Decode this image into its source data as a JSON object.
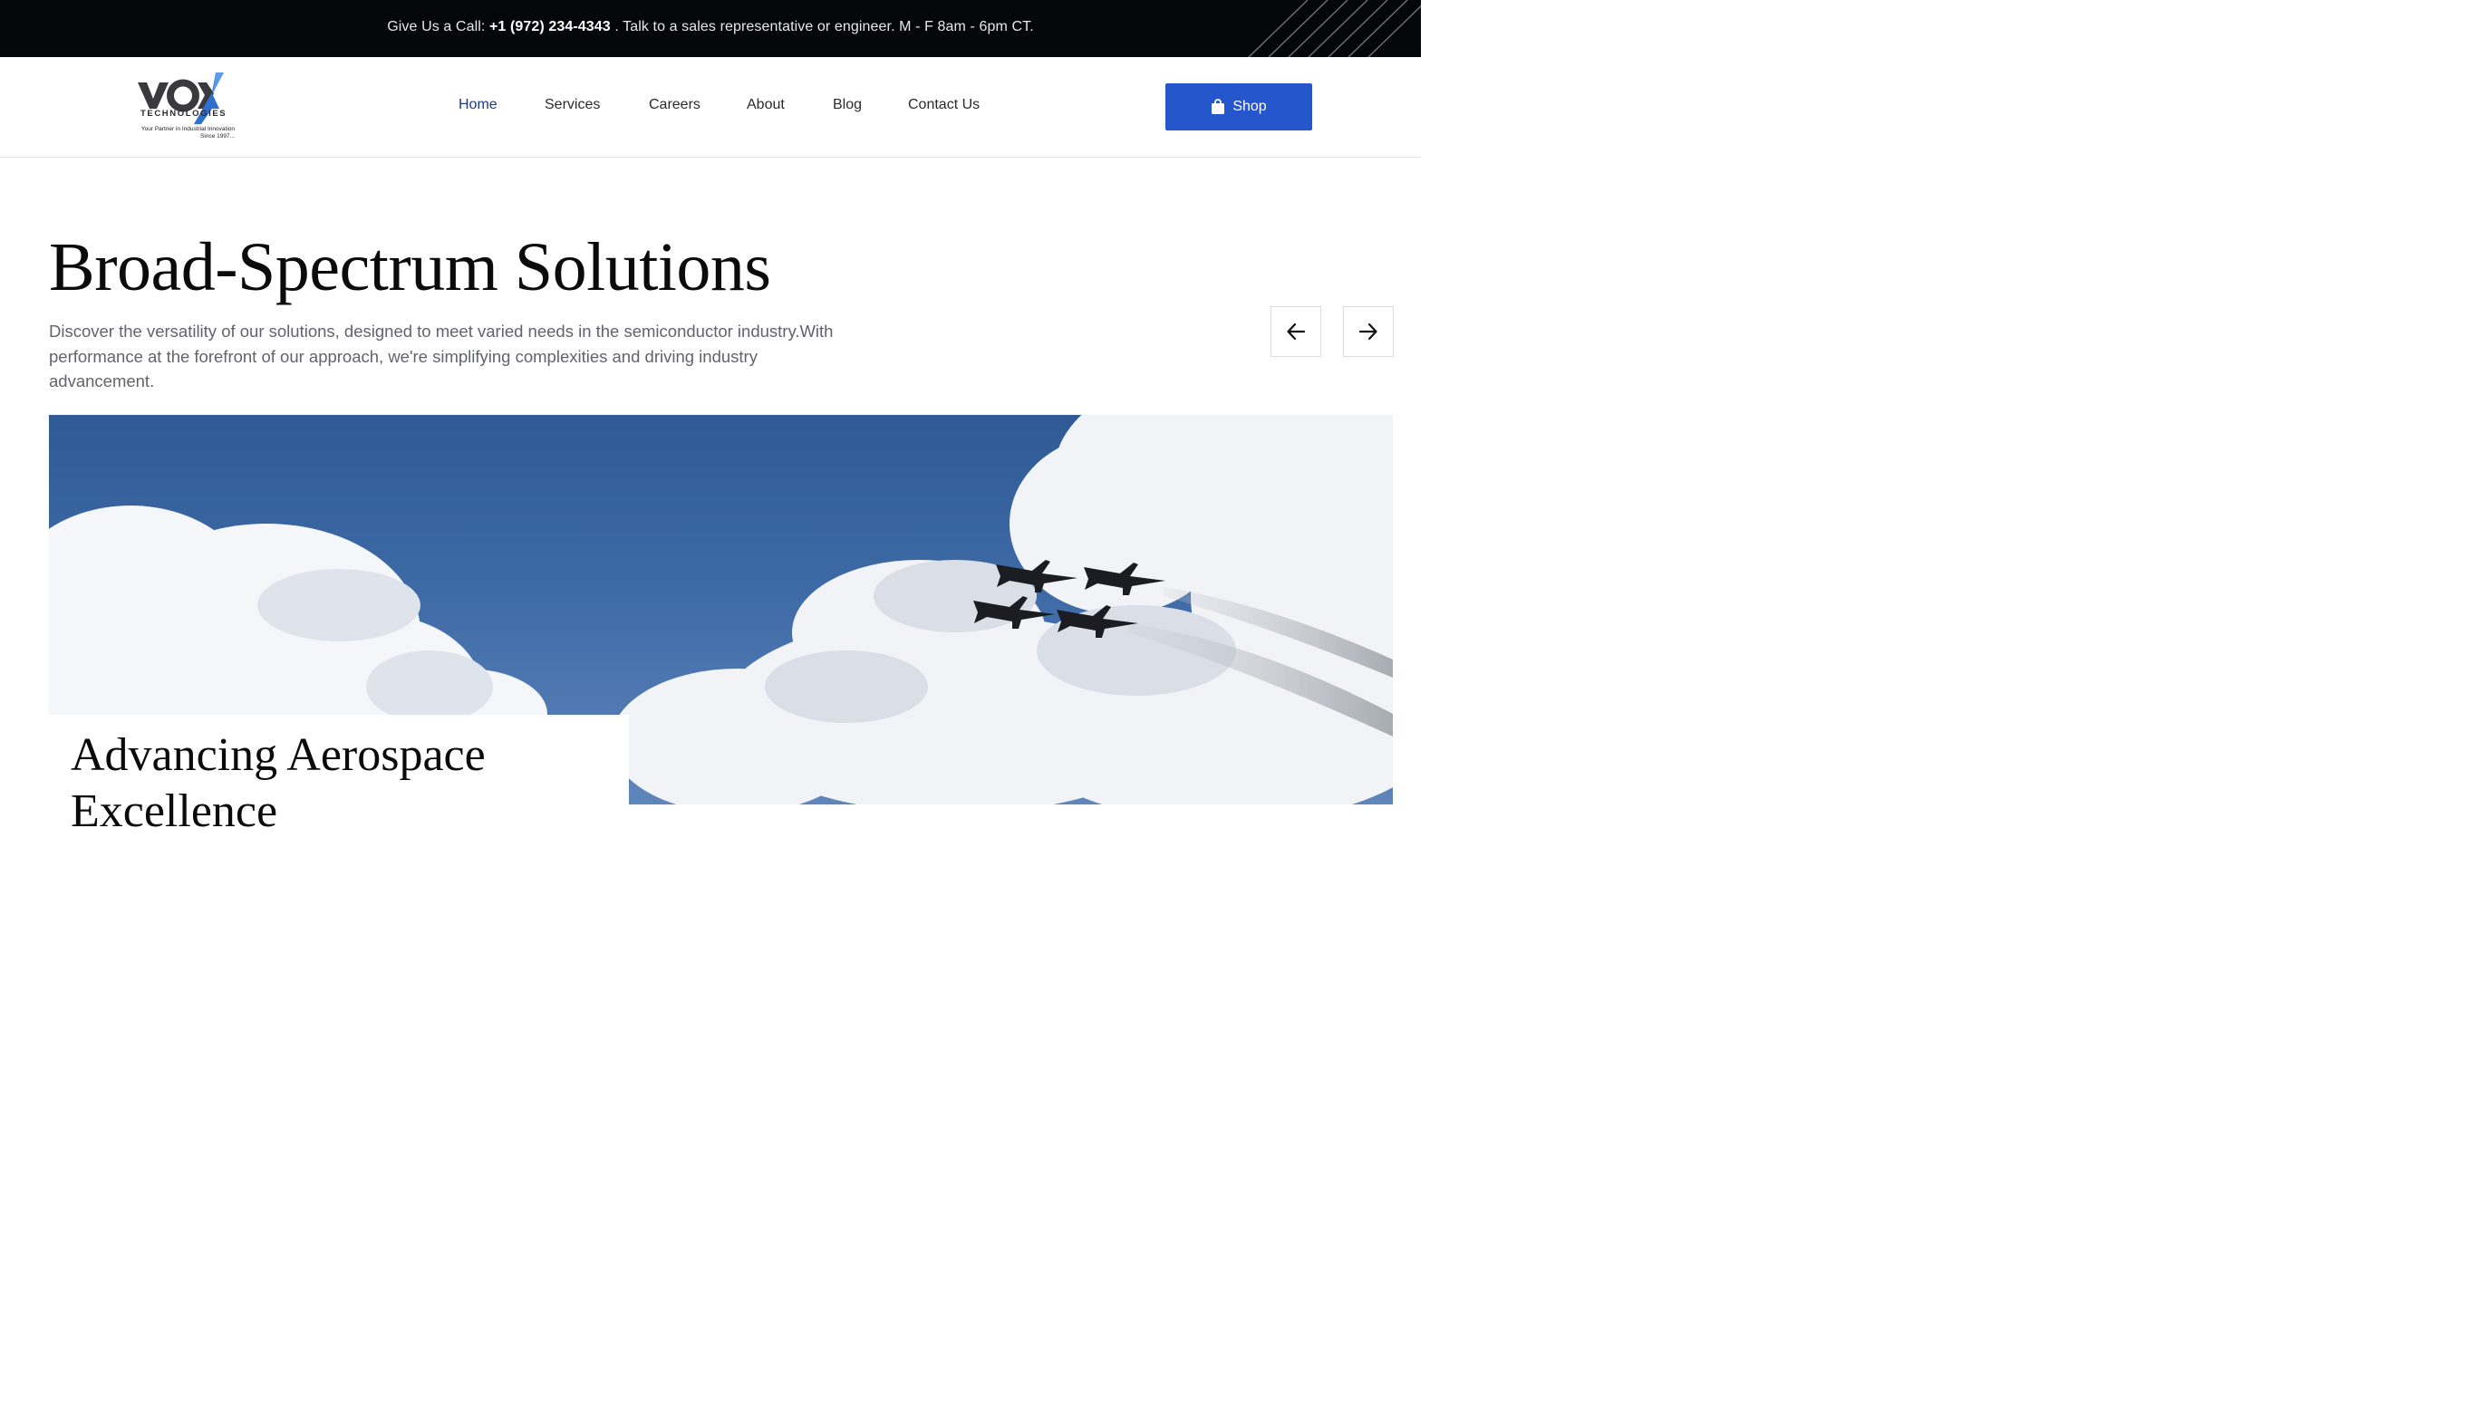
{
  "topbar": {
    "call_prefix": "Give Us a Call:",
    "phone": "+1 (972) 234-4343",
    "call_suffix": ". Talk to a sales representative or engineer.  M - F 8am - 6pm CT."
  },
  "header": {
    "logo": {
      "wordmark": "VOX",
      "subtext": "TECHNOLOGIES",
      "tagline_line1": "Your Partner in Industrial Innovation",
      "tagline_line2": "Since 1997..."
    },
    "nav": [
      {
        "label": "Home",
        "active": true
      },
      {
        "label": "Services",
        "active": false
      },
      {
        "label": "Careers",
        "active": false
      },
      {
        "label": "About",
        "active": false
      },
      {
        "label": "Blog",
        "active": false
      },
      {
        "label": "Contact Us",
        "active": false
      }
    ],
    "shop_label": "Shop",
    "shop_icon": "shopping-bag-icon"
  },
  "hero": {
    "title": "Broad-Spectrum Solutions",
    "description": "Discover the versatility of our solutions, designed to meet varied needs in the semiconductor industry.With performance at the forefront of our approach, we're simplifying complexities and driving industry advancement.",
    "prev_icon": "arrow-left-icon",
    "next_icon": "arrow-right-icon"
  },
  "slide": {
    "title": "Advancing Aerospace Excellence",
    "image": "jets-formation-in-cloudy-sky"
  },
  "colors": {
    "topbar_bg": "#05060a",
    "accent": "#2556cc",
    "nav_active": "#1d3a8a",
    "sky": "#3e6aa6"
  }
}
